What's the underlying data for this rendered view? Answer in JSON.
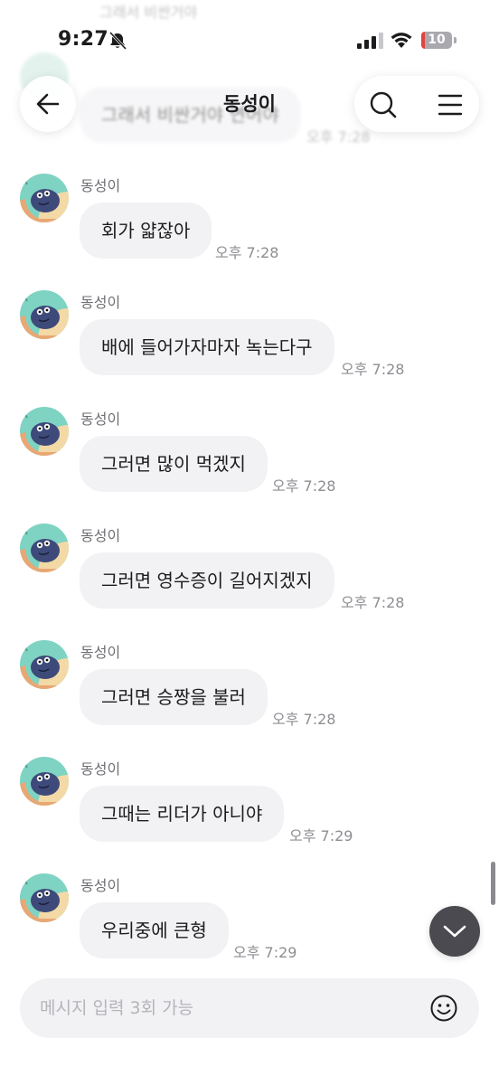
{
  "status_bar": {
    "time": "9:27",
    "battery": "10",
    "battery_level": 0.1,
    "icons": [
      "bell-slash-icon",
      "signal-icon",
      "wifi-icon",
      "battery-icon"
    ]
  },
  "header": {
    "title": "동성이",
    "back_icon": "arrow-left-icon",
    "search_icon": "search-icon",
    "menu_icon": "hamburger-menu-icon"
  },
  "faded_previous": {
    "top_text": "그래서 비싼거야",
    "sender": "동성이",
    "text": "그래서 비싼거야 연어야",
    "time": "오후 7:28"
  },
  "messages": [
    {
      "sender": "동성이",
      "text": "회가 얇잖아",
      "time": "오후 7:28"
    },
    {
      "sender": "동성이",
      "text": "배에 들어가자마자 녹는다구",
      "time": "오후 7:28"
    },
    {
      "sender": "동성이",
      "text": "그러면 많이 먹겠지",
      "time": "오후 7:28"
    },
    {
      "sender": "동성이",
      "text": "그러면 영수증이 길어지겠지",
      "time": "오후 7:28"
    },
    {
      "sender": "동성이",
      "text": "그러면 승짱을 불러",
      "time": "오후 7:28"
    },
    {
      "sender": "동성이",
      "text": "그때는 리더가 아니야",
      "time": "오후 7:29"
    },
    {
      "sender": "동성이",
      "text": "우리중에 큰형",
      "time": "오후 7:29"
    }
  ],
  "input": {
    "placeholder": "메시지 입력 3회 가능",
    "value": "",
    "emoji_icon": "smiley-icon"
  },
  "colors": {
    "bubble": "#f2f2f5",
    "time_text": "#8e8e93",
    "scroll_button": "#4a4a50",
    "battery_low": "#e0443c"
  }
}
